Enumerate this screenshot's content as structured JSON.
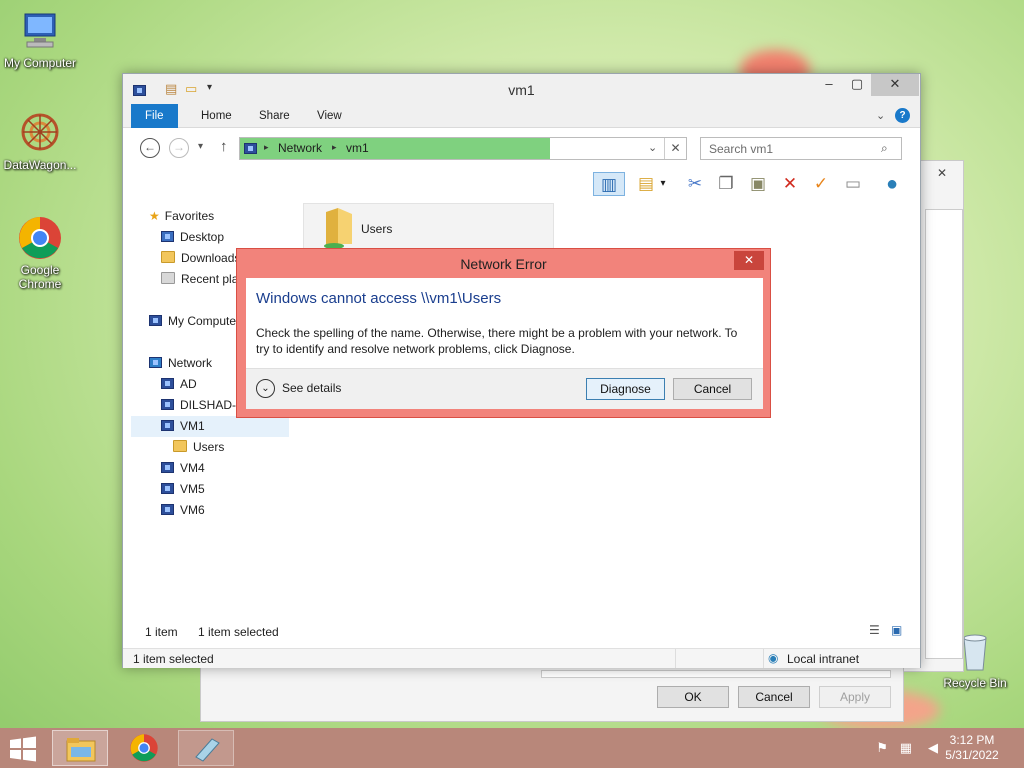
{
  "desktop": {
    "icons": [
      {
        "label": "My Computer"
      },
      {
        "label": "DataWagon..."
      },
      {
        "label": "Google Chrome"
      },
      {
        "label": "Recycle Bin"
      }
    ]
  },
  "explorer": {
    "title": "vm1",
    "ribbon_tabs": [
      "File",
      "Home",
      "Share",
      "View"
    ],
    "address": {
      "crumbs": [
        "Network",
        "vm1"
      ]
    },
    "search": {
      "placeholder": "Search vm1"
    },
    "nav": {
      "favorites": "Favorites",
      "desktop": "Desktop",
      "downloads": "Downloads",
      "recent": "Recent places",
      "my_computer": "My Computer",
      "network": "Network",
      "ad": "AD",
      "dilshad": "DILSHAD-S",
      "vm1": "VM1",
      "users": "Users",
      "vm4": "VM4",
      "vm5": "VM5",
      "vm6": "VM6"
    },
    "content_item": "Users",
    "status": {
      "count": "1 item",
      "selected": "1 item selected"
    },
    "statusbar": {
      "selected": "1 item selected",
      "zone": "Local intranet"
    }
  },
  "dialog": {
    "title": "Network Error",
    "main": "Windows cannot access \\\\vm1\\Users",
    "message": "Check the spelling of the name. Otherwise, there might be a problem with your network. To try to identify and resolve network problems, click Diagnose.",
    "details": "See details",
    "diagnose": "Diagnose",
    "cancel": "Cancel"
  },
  "back_dialog": {
    "ok": "OK",
    "cancel": "Cancel",
    "apply": "Apply"
  },
  "taskbar": {
    "time": "3:12 PM",
    "date": "5/31/2022"
  }
}
